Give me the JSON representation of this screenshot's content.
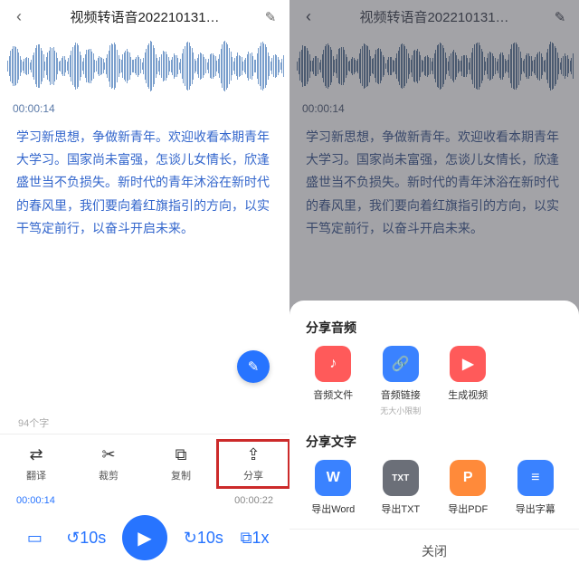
{
  "header": {
    "title": "视频转语音202210131…",
    "back_icon": "‹",
    "edit_icon": "✎"
  },
  "timestamp": "00:00:14",
  "transcript": "学习新思想，争做新青年。欢迎收看本期青年大学习。国家尚未富强，怎谈儿女情长，欣逢盛世当不负损失。新时代的青年沐浴在新时代的春风里，我们要向着红旗指引的方向，以实干笃定前行，以奋斗开启未来。",
  "char_count": "94个字",
  "actions": {
    "translate": "翻译",
    "crop": "裁剪",
    "copy": "复制",
    "share": "分享"
  },
  "timebar": {
    "current": "00:00:14",
    "total": "00:00:22"
  },
  "fab_icon": "✎",
  "player_icons": {
    "marker": "▭",
    "back10": "↺10s",
    "play": "▶",
    "fwd10": "↻10s",
    "speed": "⧉1x"
  },
  "share_sheet": {
    "audio_title": "分享音频",
    "audio_items": [
      {
        "label": "音频文件",
        "icon": "♪",
        "sub": ""
      },
      {
        "label": "音频链接",
        "icon": "🔗",
        "sub": "无大小限制"
      },
      {
        "label": "生成视频",
        "icon": "▶",
        "sub": ""
      }
    ],
    "text_title": "分享文字",
    "text_items": [
      {
        "label": "导出Word",
        "icon": "W"
      },
      {
        "label": "导出TXT",
        "icon": "TXT"
      },
      {
        "label": "导出PDF",
        "icon": "P"
      },
      {
        "label": "导出字幕",
        "icon": "≡"
      }
    ],
    "close": "关闭"
  }
}
